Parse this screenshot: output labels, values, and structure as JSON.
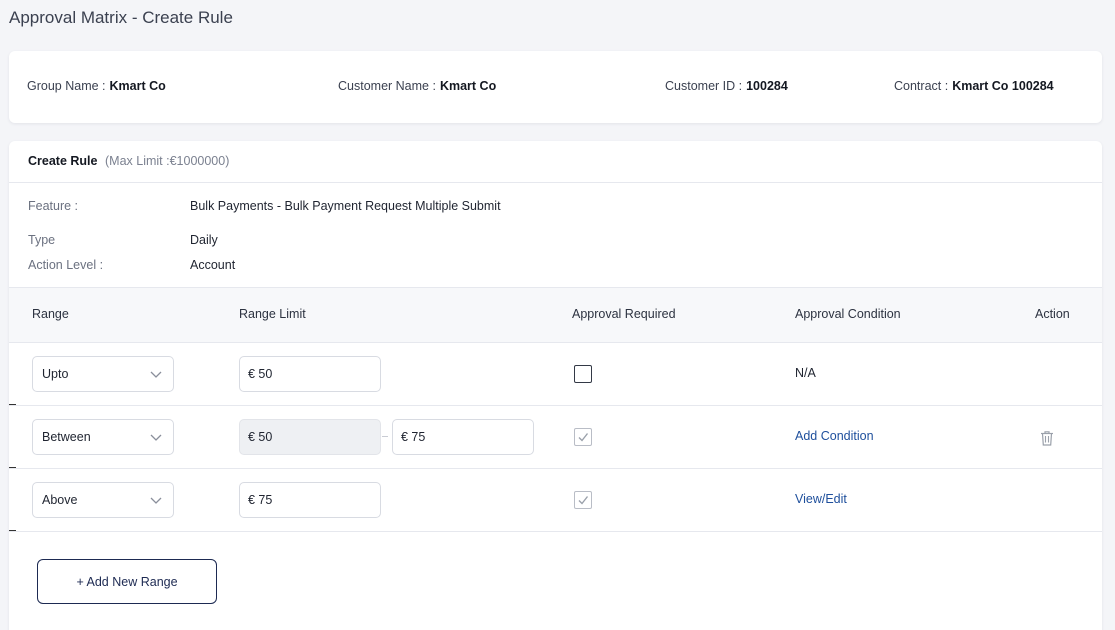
{
  "page": {
    "title": "Approval Matrix - Create Rule"
  },
  "info": {
    "group_label": "Group Name :",
    "group_value": "Kmart Co",
    "customer_label": "Customer Name :",
    "customer_value": "Kmart Co",
    "customer_id_label": "Customer ID :",
    "customer_id_value": "100284",
    "contract_label": "Contract :",
    "contract_value": "Kmart Co 100284"
  },
  "rule": {
    "title": "Create Rule",
    "max_limit": "(Max Limit :€1000000)",
    "feature_label": "Feature :",
    "feature_value": "Bulk Payments - Bulk Payment Request Multiple Submit",
    "type_label": "Type",
    "type_value": "Daily",
    "action_level_label": "Action Level :",
    "action_level_value": "Account"
  },
  "table": {
    "headers": [
      "Range",
      "Range Limit",
      "Approval Required",
      "Approval Condition",
      "Action"
    ],
    "rows": [
      {
        "range": "Upto",
        "limit_from": "€ 50",
        "approval_required": false,
        "condition": "N/A"
      },
      {
        "range": "Between",
        "limit_from": "€ 50",
        "limit_to": "€ 75",
        "approval_required": true,
        "condition": "Add Condition"
      },
      {
        "range": "Above",
        "limit_from": "€ 75",
        "approval_required": true,
        "condition": "View/Edit"
      }
    ]
  },
  "buttons": {
    "add_range": "+ Add New Range"
  },
  "icons": {
    "select": "chevron-down-icon",
    "checkbox": "checkmark-icon",
    "delete": "trash-icon"
  },
  "colors": {
    "link": "#1e4f9c",
    "button_border": "#1d2a52"
  }
}
